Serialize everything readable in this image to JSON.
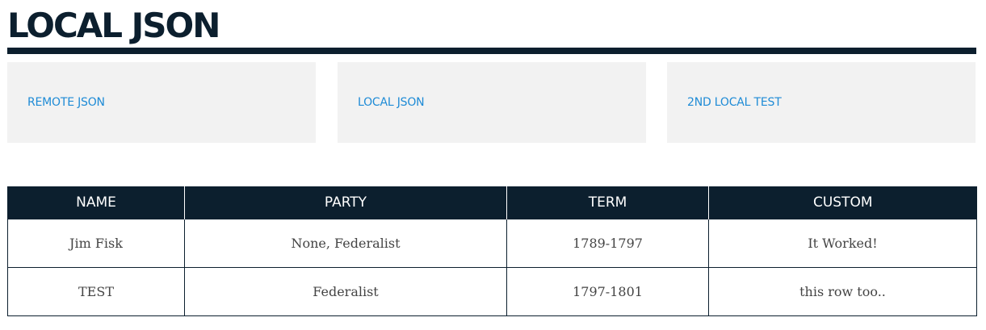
{
  "page": {
    "title": "LOCAL JSON"
  },
  "nav": {
    "items": [
      {
        "label": "REMOTE JSON"
      },
      {
        "label": "LOCAL JSON"
      },
      {
        "label": "2ND LOCAL TEST"
      }
    ]
  },
  "table": {
    "headers": [
      "NAME",
      "PARTY",
      "TERM",
      "CUSTOM"
    ],
    "rows": [
      [
        "Jim Fisk",
        "None, Federalist",
        "1789-1797",
        "It Worked!"
      ],
      [
        "TEST",
        "Federalist",
        "1797-1801",
        "this row too.."
      ]
    ]
  },
  "colors": {
    "primary": "#0c1f2e",
    "link": "#1e8bd6",
    "card_bg": "#f2f2f2",
    "cell_text": "#444444"
  }
}
